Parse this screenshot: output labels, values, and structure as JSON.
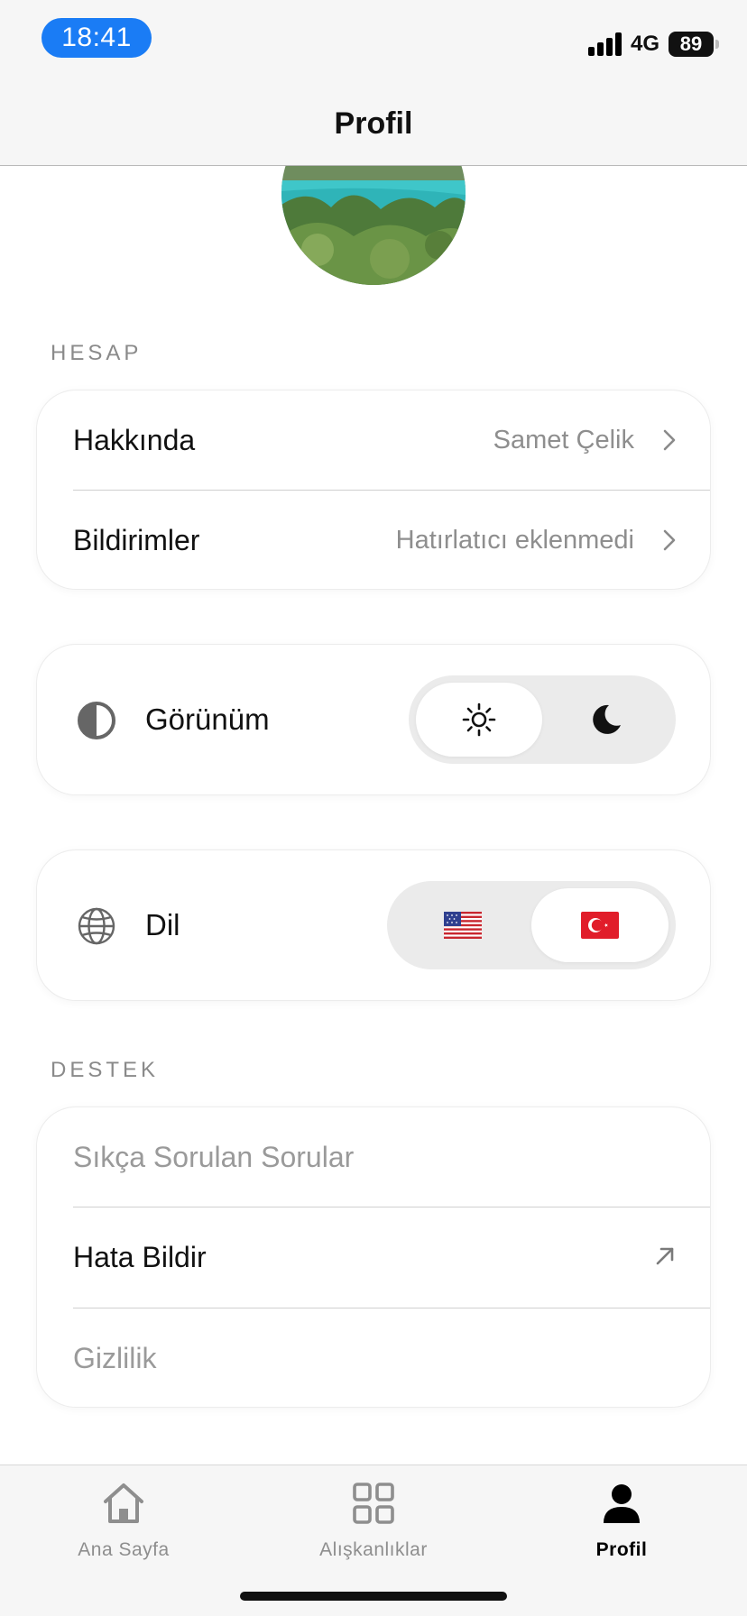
{
  "status_bar": {
    "time": "18:41",
    "network": "4G",
    "battery": "89"
  },
  "header": {
    "title": "Profil"
  },
  "avatar": {
    "description_icon": "profile-photo"
  },
  "account": {
    "section_label": "HESAP",
    "rows": [
      {
        "label": "Hakkında",
        "value": "Samet Çelik"
      },
      {
        "label": "Bildirimler",
        "value": "Hatırlatıcı eklenmedi"
      }
    ]
  },
  "appearance": {
    "label": "Görünüm",
    "selected": "light",
    "options": [
      "sun-icon",
      "moon-icon"
    ]
  },
  "language": {
    "label": "Dil",
    "selected": "tr",
    "options": [
      "us-flag-icon",
      "turkey-flag-icon"
    ]
  },
  "support": {
    "section_label": "DESTEK",
    "rows": [
      {
        "label": "Sıkça Sorulan Sorular"
      },
      {
        "label": "Hata Bildir"
      },
      {
        "label": "Gizlilik"
      }
    ]
  },
  "tabbar": {
    "items": [
      {
        "label": "Ana Sayfa",
        "icon": "home-icon",
        "active": false
      },
      {
        "label": "Alışkanlıklar",
        "icon": "grid-icon",
        "active": false
      },
      {
        "label": "Profil",
        "icon": "person-icon",
        "active": true
      }
    ]
  },
  "colors": {
    "accent": "#1a7cf5",
    "muted_text": "#8e8e8e",
    "toggle_track": "#ebebeb"
  }
}
